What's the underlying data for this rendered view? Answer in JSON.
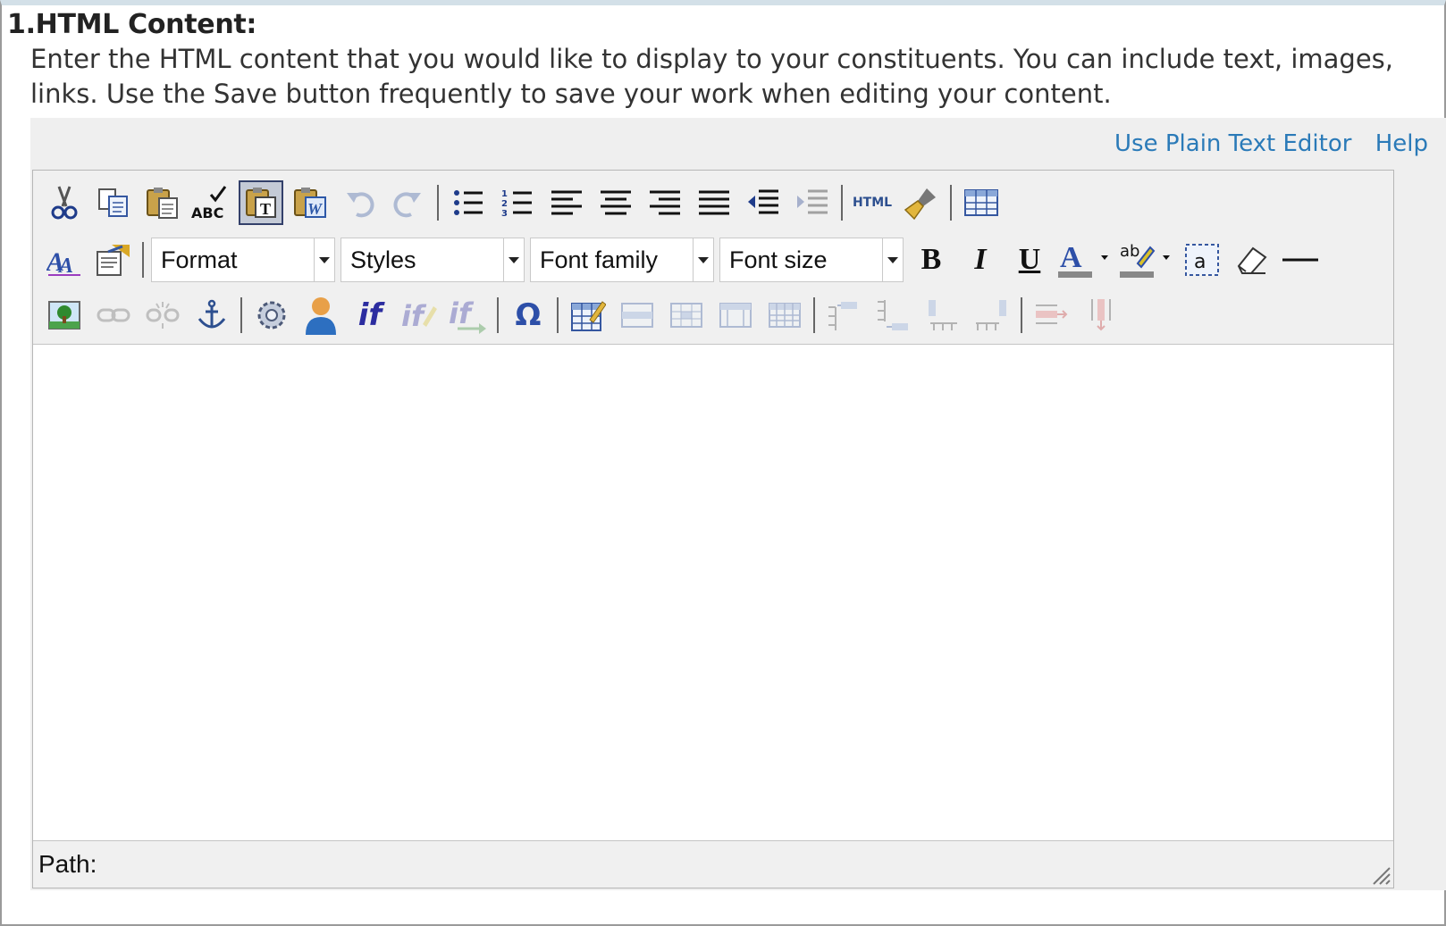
{
  "section": {
    "heading": "1.HTML Content:",
    "description_line1": "Enter the HTML content that you would like to display to your constituents. You can include text, images,",
    "description_line2": "links. Use the Save button frequently to save your work when editing your content."
  },
  "editor": {
    "plain_text_link": "Use Plain Text Editor",
    "help_link": "Help",
    "format_label": "Format",
    "styles_label": "Styles",
    "font_family_label": "Font family",
    "font_size_label": "Font size",
    "html_button_label": "HTML",
    "path_label": "Path:",
    "toolbar_row1_icons": [
      "cut-icon",
      "copy-icon",
      "paste-icon",
      "spellcheck-icon",
      "paste-text-icon",
      "paste-word-icon",
      "undo-icon",
      "redo-icon",
      "bullet-list-icon",
      "numbered-list-icon",
      "align-left-icon",
      "align-center-icon",
      "align-right-icon",
      "align-justify-icon",
      "outdent-icon",
      "indent-icon",
      "html-source-icon",
      "cleanup-icon",
      "table-icon"
    ],
    "toolbar_row2_icons": [
      "style-icon",
      "properties-icon",
      "bold-icon",
      "italic-icon",
      "underline-icon",
      "font-color-icon",
      "highlight-color-icon",
      "visual-aid-icon",
      "eraser-icon",
      "horizontal-rule-icon"
    ],
    "toolbar_row3_icons": [
      "image-icon",
      "link-icon",
      "unlink-icon",
      "anchor-icon",
      "gear-icon",
      "person-icon",
      "if-icon",
      "if-edit-icon",
      "if-else-icon",
      "special-char-icon",
      "table-props-icon",
      "row-props-icon",
      "cell-props-icon",
      "merge-cells-icon",
      "split-cells-icon",
      "insert-row-before-icon",
      "insert-row-after-icon",
      "insert-col-before-icon",
      "insert-col-after-icon",
      "delete-row-icon",
      "delete-col-icon"
    ],
    "colors": {
      "link": "#2a7ab8",
      "toolbar_bg": "#f0f0f0",
      "active_border": "#33406a"
    }
  }
}
